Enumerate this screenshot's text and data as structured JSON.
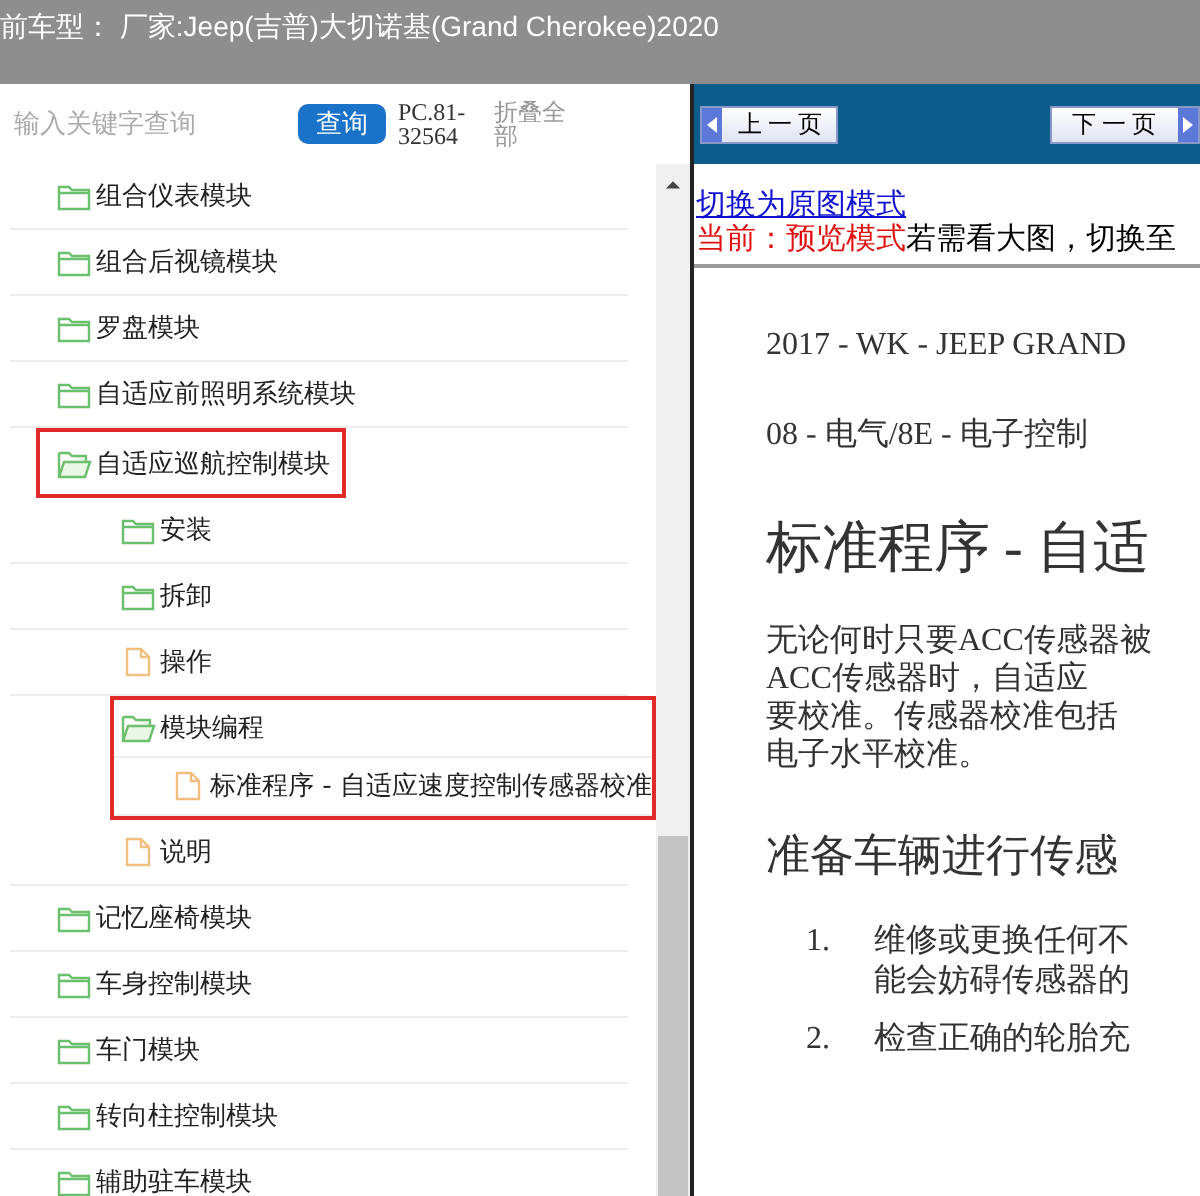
{
  "title": "前车型： 厂家:Jeep(吉普)大切诺基(Grand Cherokee)2020",
  "search": {
    "placeholder": "输入关键字查询",
    "button": "查询",
    "code": "PC.81-32564",
    "collapse_all": "折叠全部"
  },
  "tree": [
    {
      "label": "组合仪表模块",
      "kind": "folder",
      "expanded": false
    },
    {
      "label": "组合后视镜模块",
      "kind": "folder",
      "expanded": false
    },
    {
      "label": "罗盘模块",
      "kind": "folder",
      "expanded": false
    },
    {
      "label": "自适应前照明系统模块",
      "kind": "folder",
      "expanded": false
    },
    {
      "label": "自适应巡航控制模块",
      "kind": "folder",
      "expanded": true,
      "highlighted": true,
      "children": [
        {
          "label": "安装",
          "kind": "folder",
          "expanded": false
        },
        {
          "label": "拆卸",
          "kind": "folder",
          "expanded": false
        },
        {
          "label": "操作",
          "kind": "file"
        },
        {
          "label": "模块编程",
          "kind": "folder",
          "expanded": true,
          "highlighted": true,
          "children": [
            {
              "label": "标准程序 - 自适应速度控制传感器校准",
              "kind": "file",
              "highlighted": true
            }
          ]
        },
        {
          "label": "说明",
          "kind": "file"
        }
      ]
    },
    {
      "label": "记忆座椅模块",
      "kind": "folder",
      "expanded": false
    },
    {
      "label": "车身控制模块",
      "kind": "folder",
      "expanded": false
    },
    {
      "label": "车门模块",
      "kind": "folder",
      "expanded": false
    },
    {
      "label": "转向柱控制模块",
      "kind": "folder",
      "expanded": false
    },
    {
      "label": "辅助驻车模块",
      "kind": "folder",
      "expanded": false
    }
  ],
  "viewer": {
    "prev_button": "上一页",
    "next_button": "下一页",
    "mode_link": "切换为原图模式",
    "mode_status": "当前：预览模式",
    "mode_hint": "若需看大图，切换至",
    "document": {
      "header_lines": [
        "2017 - WK - JEEP GRAND",
        "08 - 电气/8E - 电子控制"
      ],
      "title": "标准程序 - 自适",
      "paragraph_lines": [
        "无论何时只要ACC传感器被",
        "ACC传感器时，自适应",
        "要校准。传感器校准包括",
        "电子水平校准。"
      ],
      "section_heading": "准备车辆进行传感",
      "steps": [
        {
          "number": "1.",
          "lines": [
            "维修或更换任何不",
            "能会妨碍传感器的"
          ]
        },
        {
          "number": "2.",
          "lines": [
            "检查正确的轮胎充"
          ]
        }
      ]
    }
  }
}
